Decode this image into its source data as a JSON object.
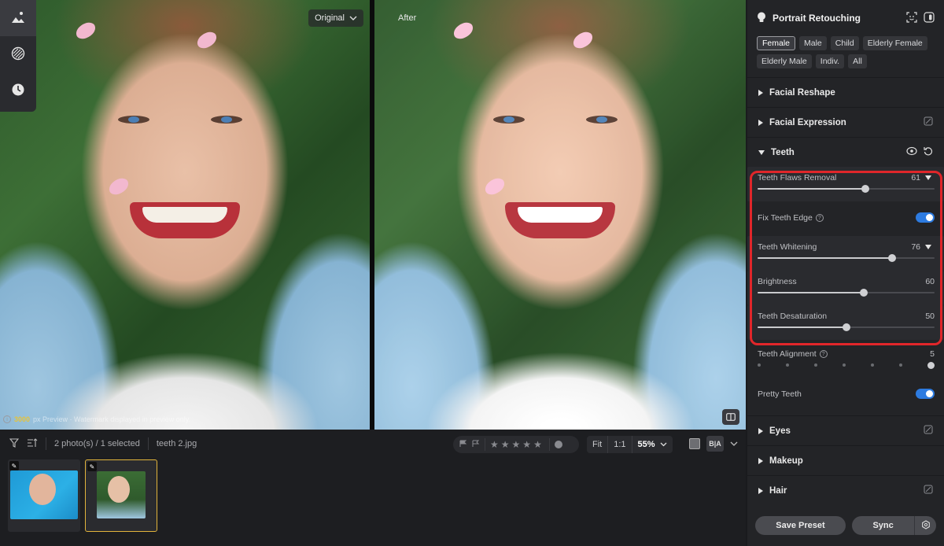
{
  "viewer": {
    "before_label": "Original",
    "after_label": "After",
    "watermark_resolution": "3000",
    "watermark_suffix": "px Preview · Watermark displayed in preview only."
  },
  "toolbar": {
    "status": "2 photo(s) / 1 selected",
    "filename": "teeth 2.jpg",
    "zoom_fit": "Fit",
    "zoom_one": "1:1",
    "zoom_pct": "55%",
    "ba_label": "B|A"
  },
  "panel": {
    "title": "Portrait Retouching",
    "chips": [
      {
        "label": "Female",
        "active": true
      },
      {
        "label": "Male"
      },
      {
        "label": "Child"
      },
      {
        "label": "Elderly Female"
      },
      {
        "label": "Elderly Male"
      },
      {
        "label": "Indiv."
      },
      {
        "label": "All"
      }
    ],
    "sections": {
      "facial_reshape": "Facial Reshape",
      "facial_expression": "Facial Expression",
      "teeth": "Teeth",
      "eyes": "Eyes",
      "makeup": "Makeup",
      "hair": "Hair"
    },
    "teeth_controls": {
      "flaws_removal": {
        "label": "Teeth Flaws Removal",
        "value": "61",
        "fraction": 0.61
      },
      "fix_edge": {
        "label": "Fix Teeth Edge",
        "enabled": true
      },
      "whitening": {
        "label": "Teeth Whitening",
        "value": "76",
        "fraction": 0.76
      },
      "brightness": {
        "label": "Brightness",
        "value": "60",
        "fraction": 0.6
      },
      "desaturation": {
        "label": "Teeth Desaturation",
        "value": "50",
        "fraction": 0.5
      },
      "alignment": {
        "label": "Teeth Alignment",
        "value": "5",
        "fraction": 1.0
      },
      "pretty_teeth": {
        "label": "Pretty Teeth",
        "enabled": true
      }
    },
    "footer": {
      "save_preset": "Save Preset",
      "sync": "Sync"
    }
  },
  "colors": {
    "accent_toggle": "#2d7be0",
    "highlight": "#e0262a",
    "selected_thumb": "#e2b43c"
  }
}
